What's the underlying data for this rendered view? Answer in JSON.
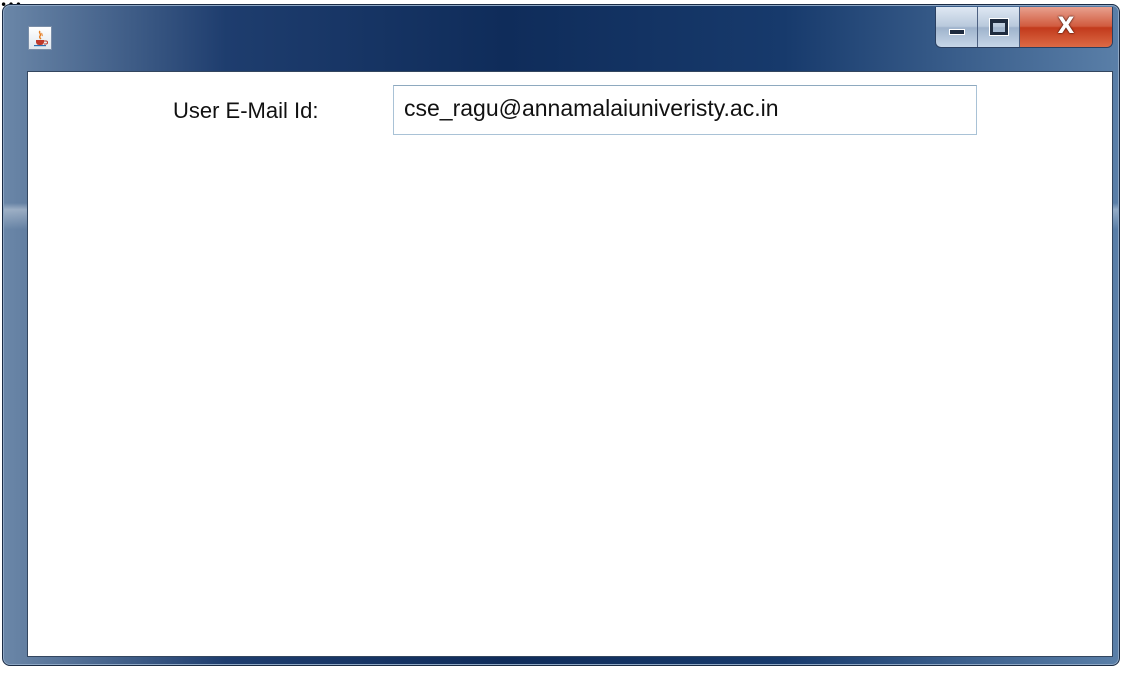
{
  "page_fragment": "…",
  "window": {
    "title": "",
    "icon": "java-cup-icon",
    "buttons": {
      "minimize_icon": "minimize-icon",
      "maximize_icon": "maximize-icon",
      "close_label": "X"
    }
  },
  "form": {
    "email_label": "User E-Mail Id:",
    "email_value": "cse_ragu@annamalaiuniveristy.ac.in"
  },
  "colors": {
    "titlebar": "#173a6c",
    "close_button": "#c23a1c",
    "field_border": "#a9c2d6"
  }
}
